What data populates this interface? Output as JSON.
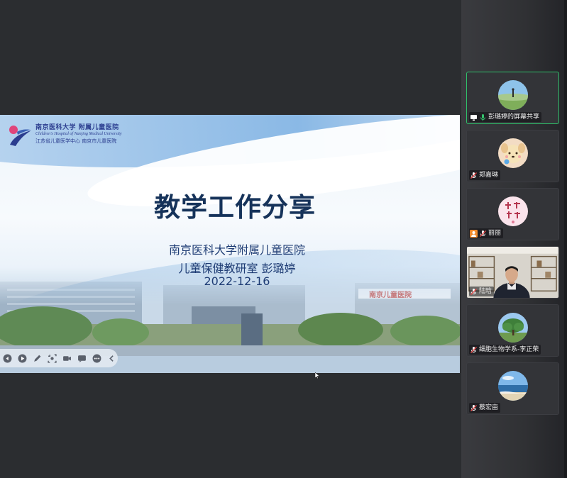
{
  "slide": {
    "logo": {
      "line1": "南京医科大学 附属儿童医院",
      "line2": "Children's Hospital of Nanjing Medical University",
      "line3": "江苏省儿童医学中心  南京市儿童医院"
    },
    "title": "教学工作分享",
    "subtitle_lines": [
      "南京医科大学附属儿童医院",
      "儿童保健教研室 彭璐婷",
      "2022-12-16"
    ],
    "building_sign": "南京儿童医院"
  },
  "presentation_toolbar": {
    "buttons": [
      "prev-icon",
      "play-icon",
      "pen-icon",
      "crop-icon",
      "camera-icon",
      "comment-icon",
      "more-icon",
      "collapse-icon"
    ]
  },
  "participants": [
    {
      "name": "彭璐婷的屏幕共享",
      "status_icons": [
        "screen-share-icon",
        "mic-on-icon"
      ],
      "avatar": "landscape-photo",
      "active": true
    },
    {
      "name": "郑嘉琳",
      "status_icons": [
        "mic-muted-icon"
      ],
      "avatar": "cartoon-dog"
    },
    {
      "name": "丽丽",
      "status_icons": [
        "host-icon",
        "mic-muted-icon"
      ],
      "avatar": "calligraphy-pink"
    },
    {
      "name": "陆晗",
      "status_icons": [
        "mic-muted-icon"
      ],
      "avatar": "camera-video"
    },
    {
      "name": "细胞生物学系-李正荣",
      "status_icons": [
        "mic-muted-icon"
      ],
      "avatar": "tree-photo"
    },
    {
      "name": "蔡宏亩",
      "status_icons": [
        "mic-muted-icon"
      ],
      "avatar": "sea-photo"
    }
  ],
  "colors": {
    "active_border": "#2fbf6a",
    "title_color": "#16335a",
    "subtitle_color": "#1e3c74",
    "background": "#2b2d30"
  }
}
